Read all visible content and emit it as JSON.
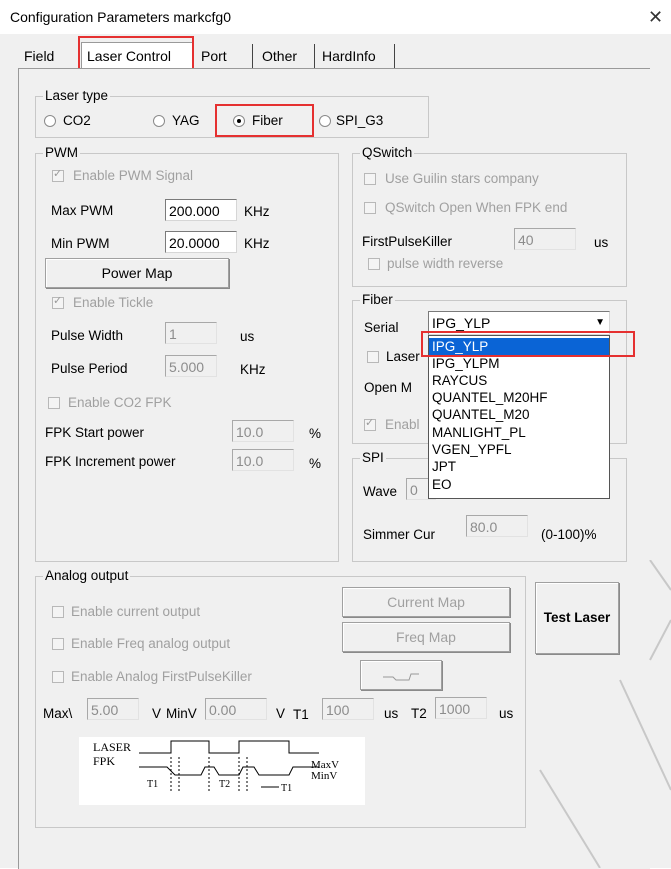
{
  "window": {
    "title": "Configuration Parameters markcfg0",
    "close_glyph": "✕"
  },
  "tabs": [
    "Field",
    "Laser Control",
    "Port",
    "Other",
    "HardInfo"
  ],
  "laser_type": {
    "legend": "Laser type",
    "options": [
      "CO2",
      "YAG",
      "Fiber",
      "SPI_G3"
    ],
    "selected": "Fiber"
  },
  "pwm": {
    "legend": "PWM",
    "enable_pwm": "Enable PWM Signal",
    "max_pwm_label": "Max PWM",
    "max_pwm_value": "200.000",
    "max_pwm_unit": "KHz",
    "min_pwm_label": "Min PWM",
    "min_pwm_value": "20.0000",
    "min_pwm_unit": "KHz",
    "power_map_button": "Power Map",
    "enable_tickle": "Enable Tickle",
    "pulse_width_label": "Pulse Width",
    "pulse_width_value": "1",
    "pulse_width_unit": "us",
    "pulse_period_label": "Pulse Period",
    "pulse_period_value": "5.000",
    "pulse_period_unit": "KHz",
    "enable_co2_fpk": "Enable CO2 FPK",
    "fpk_start_label": "FPK Start power",
    "fpk_start_value": "10.0",
    "fpk_start_unit": "%",
    "fpk_inc_label": "FPK Increment power",
    "fpk_inc_value": "10.0",
    "fpk_inc_unit": "%"
  },
  "qswitch": {
    "legend": "QSwitch",
    "use_guilin": "Use Guilin stars company",
    "open_when_fpk": "QSwitch Open When FPK end",
    "fpk_label": "FirstPulseKiller",
    "fpk_value": "40",
    "fpk_unit": "us",
    "pulse_reverse": "pulse width reverse"
  },
  "fiber": {
    "legend": "Fiber",
    "serial_label": "Serial",
    "serial_value": "IPG_YLP",
    "laser_label_partial": "Laser",
    "open_label_partial": "Open M",
    "enable_partial": "Enabl",
    "dropdown_options": [
      "IPG_YLP",
      "IPG_YLPM",
      "RAYCUS",
      "QUANTEL_M20HF",
      "QUANTEL_M20",
      "MANLIGHT_PL",
      "VGEN_YPFL",
      "JPT",
      "EO"
    ],
    "dropdown_selected": "IPG_YLP"
  },
  "spi": {
    "legend": "SPI",
    "wave_label": "Wave",
    "wave_value": "0",
    "simmer_label": "Simmer Cur",
    "simmer_value": "80.0",
    "simmer_unit": "(0-100)%"
  },
  "analog": {
    "legend": "Analog output",
    "enable_current": "Enable current output",
    "current_map_button": "Current Map",
    "enable_freq": "Enable Freq analog output",
    "freq_map_button": "Freq Map",
    "enable_fpk": "Enable Analog FirstPulseKiller",
    "maxv_label": "Max\\",
    "maxv_value": "5.00",
    "maxv_unit": "V",
    "minv_label": "MinV",
    "minv_value": "0.00",
    "minv_unit": "V",
    "t1_label": "T1",
    "t1_value": "100",
    "t1_unit": "us",
    "t2_label": "T2",
    "t2_value": "1000",
    "t2_unit": "us"
  },
  "diagram": {
    "laser": "LASER",
    "fpk": "FPK",
    "maxv": "MaxV",
    "minv": "MinV",
    "t1": "T1",
    "t2": "T2"
  },
  "test_laser_button": "Test Laser"
}
